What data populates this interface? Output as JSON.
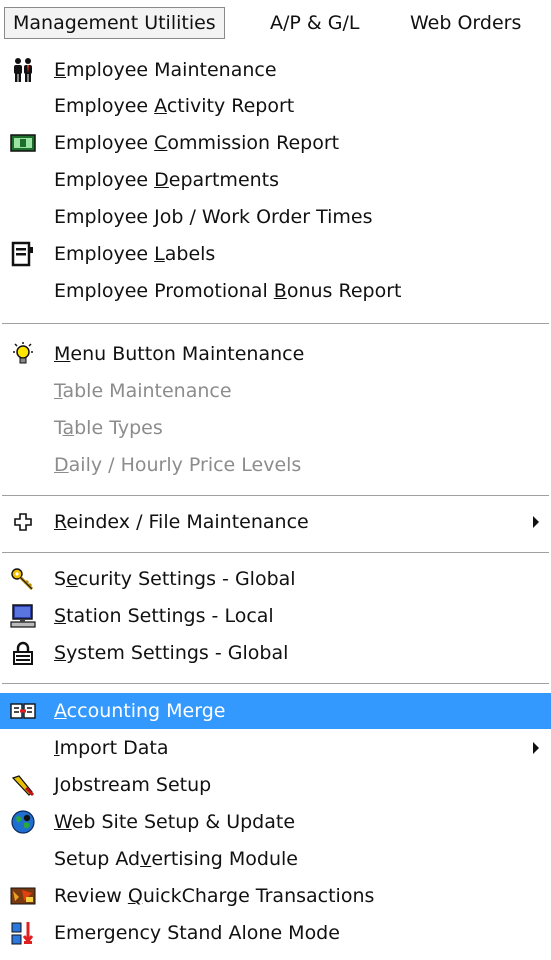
{
  "menubar": {
    "items": [
      "Management Utilities",
      "A/P & G/L",
      "Web Orders"
    ]
  },
  "menu": {
    "items": [
      {
        "pre": "",
        "key": "E",
        "post": "mployee Maintenance",
        "icon": "employees-icon"
      },
      {
        "pre": "Employee ",
        "key": "A",
        "post": "ctivity Report",
        "icon": ""
      },
      {
        "pre": "Employee ",
        "key": "C",
        "post": "ommission Report",
        "icon": "money-icon"
      },
      {
        "pre": "Employee ",
        "key": "D",
        "post": "epartments",
        "icon": ""
      },
      {
        "pre": "Employee ",
        "key": "J",
        "post": "ob / Work Order Times",
        "icon": ""
      },
      {
        "pre": "Employee ",
        "key": "L",
        "post": "abels",
        "icon": "label-icon"
      },
      {
        "pre": "Employee Promotional ",
        "key": "B",
        "post": "onus Report",
        "icon": ""
      },
      {
        "pre": "",
        "key": "M",
        "post": "enu Button Maintenance",
        "icon": "lightbulb-icon"
      },
      {
        "pre": "",
        "key": "T",
        "post": "able Maintenance",
        "icon": ""
      },
      {
        "pre": "T",
        "key": "a",
        "post": "ble Types",
        "icon": ""
      },
      {
        "pre": "",
        "key": "D",
        "post": "aily / Hourly Price Levels",
        "icon": ""
      },
      {
        "pre": "",
        "key": "R",
        "post": "eindex / File Maintenance",
        "icon": "cross-icon"
      },
      {
        "pre": "S",
        "key": "e",
        "post": "curity Settings - Global",
        "icon": "keys-icon"
      },
      {
        "pre": "",
        "key": "S",
        "post": "tation Settings - Local",
        "icon": "computer-icon"
      },
      {
        "pre": "",
        "key": "S",
        "post": "ystem Settings - Global",
        "icon": "lock-icon"
      },
      {
        "pre": "",
        "key": "A",
        "post": "ccounting Merge",
        "icon": "merge-icon"
      },
      {
        "pre": "",
        "key": "I",
        "post": "mport Data",
        "icon": ""
      },
      {
        "pre": "",
        "key": "J",
        "post": "obstream Setup",
        "icon": "wrench-icon"
      },
      {
        "pre": "",
        "key": "W",
        "post": "eb Site Setup & Update",
        "icon": "globe-icon"
      },
      {
        "pre": "Setup Ad",
        "key": "v",
        "post": "ertising Module",
        "icon": ""
      },
      {
        "pre": "Review ",
        "key": "Q",
        "post": "uickCharge Transactions",
        "icon": "transactions-icon"
      },
      {
        "pre": "",
        "key": "",
        "post": "Emergency Stand Alone Mode",
        "icon": "emergency-icon"
      }
    ]
  }
}
